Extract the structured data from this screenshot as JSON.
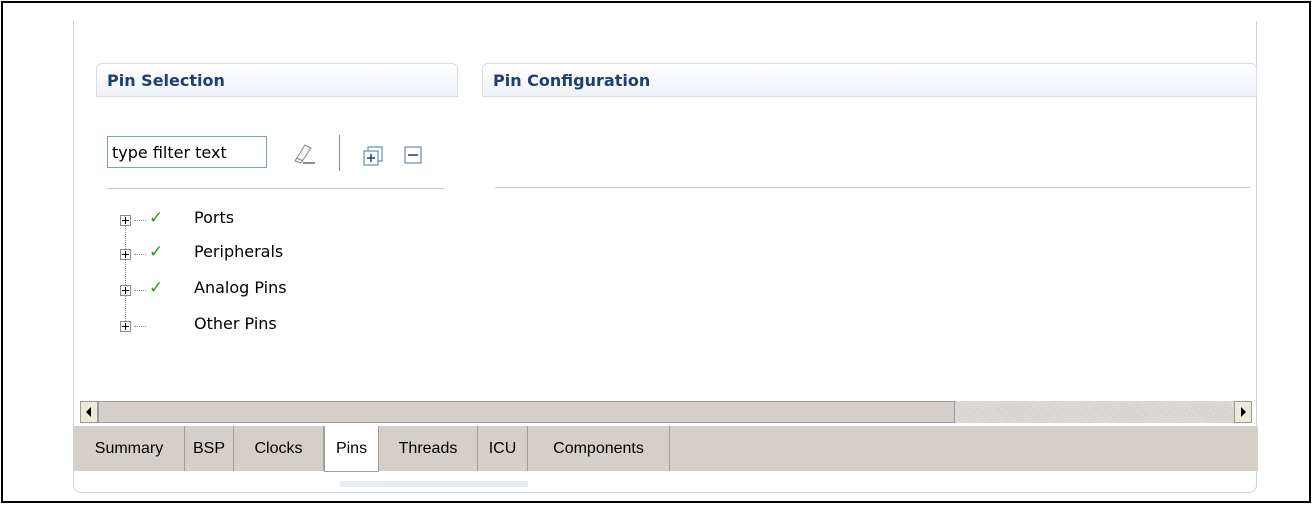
{
  "sections": {
    "pin_selection_title": "Pin Selection",
    "pin_configuration_title": "Pin Configuration"
  },
  "filter": {
    "placeholder": "type filter text"
  },
  "toolbar": {
    "clear_icon": "clear-filter-icon",
    "expand_icon": "expand-all-icon",
    "collapse_icon": "collapse-all-icon"
  },
  "tree": {
    "items": [
      {
        "label": "Ports",
        "checked": true
      },
      {
        "label": "Peripherals",
        "checked": true
      },
      {
        "label": "Analog Pins",
        "checked": true
      },
      {
        "label": "Other Pins",
        "checked": false
      }
    ],
    "check_glyph": "✓"
  },
  "tabs": [
    {
      "label": "Summary"
    },
    {
      "label": "BSP"
    },
    {
      "label": "Clocks"
    },
    {
      "label": "Pins",
      "active": true
    },
    {
      "label": "Threads"
    },
    {
      "label": "ICU"
    },
    {
      "label": "Components"
    }
  ],
  "colors": {
    "header_text": "#1f3e72",
    "check": "#2a9c2a",
    "tabbar": "#d4d0c8"
  }
}
